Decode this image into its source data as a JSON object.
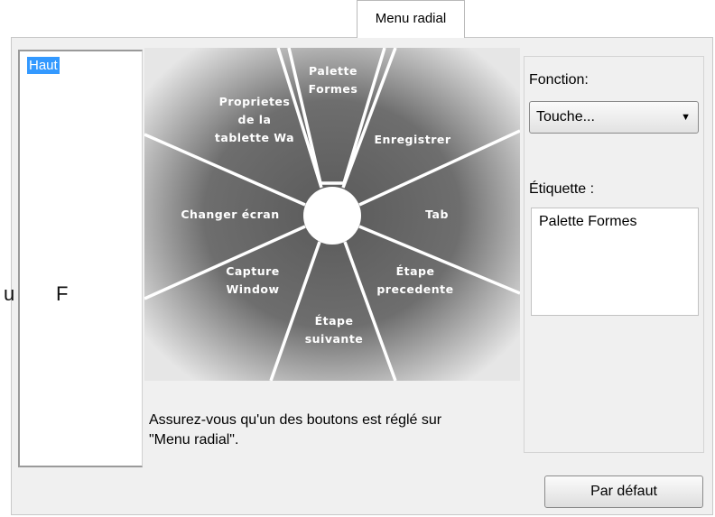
{
  "tab": {
    "label": "Menu radial"
  },
  "list": {
    "items": [
      "Haut"
    ]
  },
  "stray_text": {
    "left": "u",
    "right": "F"
  },
  "radial": {
    "segments": [
      {
        "lines": [
          "Palette",
          "Formes"
        ]
      },
      {
        "lines": [
          "Enregistrer"
        ]
      },
      {
        "lines": [
          "Tab"
        ]
      },
      {
        "lines": [
          "Étape",
          "precedente"
        ]
      },
      {
        "lines": [
          "Étape",
          "suivante"
        ]
      },
      {
        "lines": [
          "Capture",
          "Window"
        ]
      },
      {
        "lines": [
          "Changer écran"
        ]
      },
      {
        "lines": [
          "Proprietes",
          "de la",
          "tablette Wa"
        ]
      }
    ]
  },
  "hint": {
    "line1": "Assurez-vous qu'un des boutons est réglé sur",
    "line2": "\"Menu radial\"."
  },
  "function": {
    "label": "Fonction:",
    "value": "Touche..."
  },
  "etiquette": {
    "label": "Étiquette :",
    "value": "Palette Formes"
  },
  "default_button": {
    "label": "Par défaut"
  },
  "colors": {
    "selection": "#3399ff",
    "panel": "#f0f0f0"
  }
}
